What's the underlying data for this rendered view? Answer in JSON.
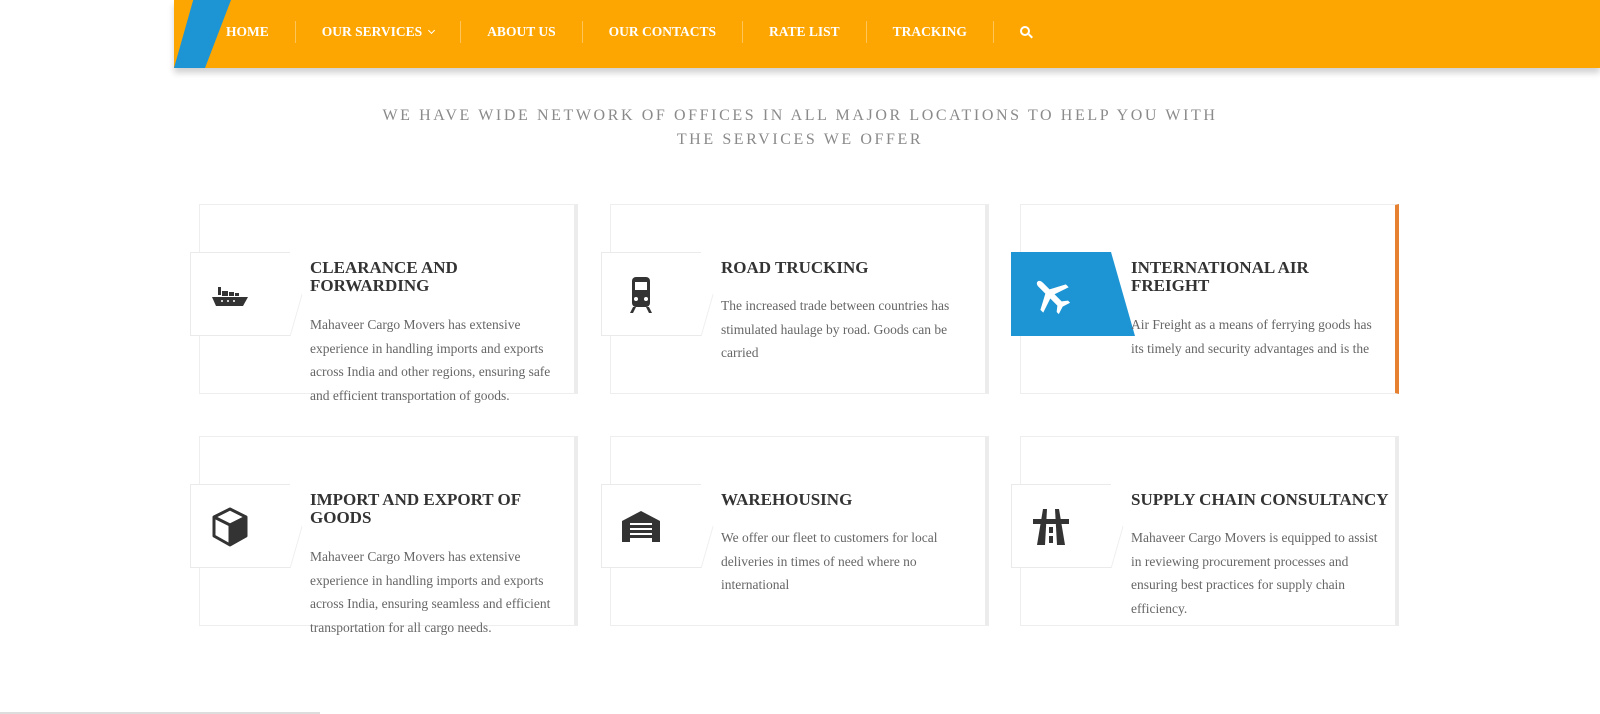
{
  "nav": {
    "items": [
      {
        "label": "HOME"
      },
      {
        "label": "OUR SERVICES"
      },
      {
        "label": "ABOUT US"
      },
      {
        "label": "OUR CONTACTS"
      },
      {
        "label": "RATE LIST"
      },
      {
        "label": "TRACKING"
      }
    ],
    "search_icon": "search-icon",
    "colors": {
      "bar": "#fda602",
      "accent": "#1d94d3"
    }
  },
  "heading": {
    "text": "WE HAVE WIDE NETWORK OF OFFICES IN ALL MAJOR LOCATIONS TO HELP YOU WITH THE SERVICES WE OFFER"
  },
  "services": [
    {
      "icon": "ship-icon",
      "title": "CLEARANCE AND FORWARDING",
      "text": "Mahaveer Cargo Movers has extensive experience in handling imports and exports across India and other regions, ensuring safe and efficient transportation of goods."
    },
    {
      "icon": "train-icon",
      "title": "ROAD TRUCKING",
      "text": "The increased trade between countries has stimulated haulage by road. Goods can be carried"
    },
    {
      "icon": "plane-icon",
      "title": "INTERNATIONAL AIR FREIGHT",
      "text": "Air Freight as a means of ferrying goods has its timely and security advantages and is the"
    },
    {
      "icon": "cube-icon",
      "title": "IMPORT AND EXPORT OF GOODS",
      "text": "Mahaveer Cargo Movers has extensive experience in handling imports and exports across India, ensuring seamless and efficient transportation for all cargo needs."
    },
    {
      "icon": "warehouse-icon",
      "title": "WAREHOUSING",
      "text": "We offer our fleet to customers for local deliveries in times of need where no international"
    },
    {
      "icon": "road-icon",
      "title": "SUPPLY CHAIN CONSULTANCY",
      "text": "Mahaveer Cargo Movers is equipped to assist in reviewing procurement processes and ensuring best practices for supply chain efficiency."
    }
  ],
  "active_card_color": "#e58130"
}
